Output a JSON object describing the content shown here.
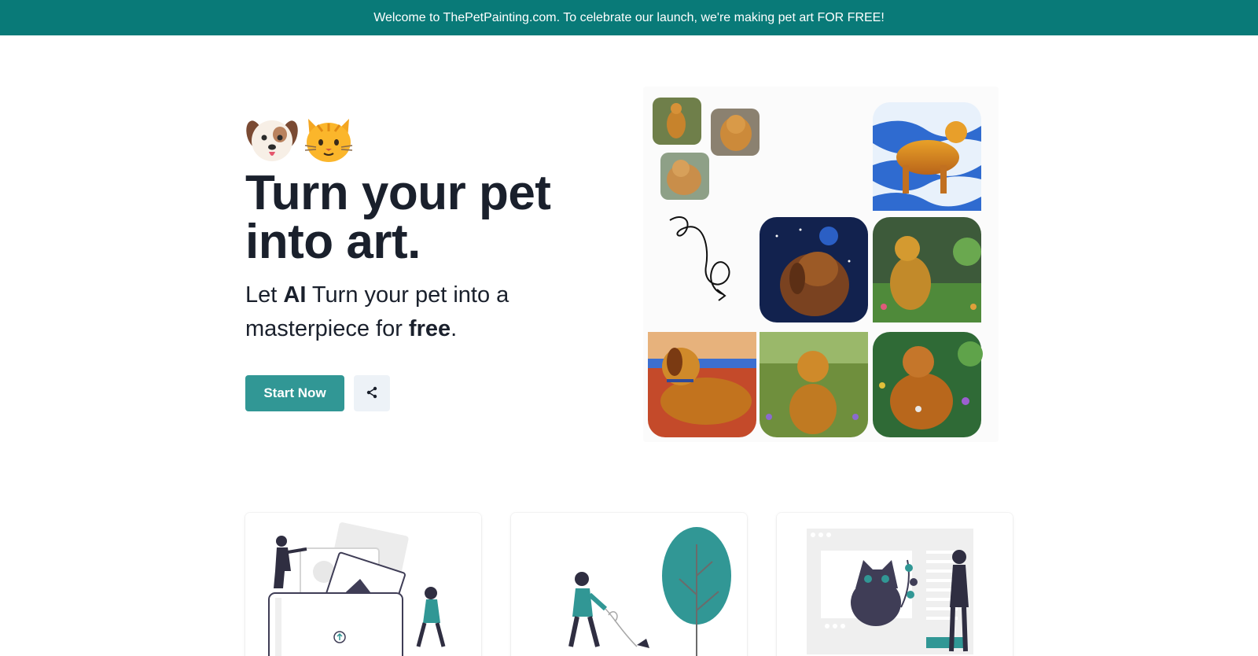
{
  "banner": {
    "text": "Welcome to ThePetPainting.com. To celebrate our launch, we're making pet art FOR FREE!"
  },
  "hero": {
    "emojis": [
      "dog-face-icon",
      "cat-face-icon"
    ],
    "headline": "Turn your pet into art.",
    "subline": {
      "part1": "Let ",
      "bold1": "AI",
      "part2": " Turn your pet into a masterpiece for ",
      "bold2": "free",
      "part3": "."
    },
    "start_label": "Start Now",
    "share_icon": "share-icon"
  },
  "gallery": {
    "items": [
      "dog-photo-small-1",
      "dog-photo-small-2",
      "dog-photo-small-3",
      "dog-painting-wave-background",
      "curly-arrow-icon",
      "dog-painting-night-sky",
      "dog-painting-garden-1",
      "dog-painting-desert",
      "dog-painting-garden-2",
      "dog-painting-garden-3"
    ]
  },
  "cards": [
    {
      "illustration": "upload-photo-illustration"
    },
    {
      "illustration": "walking-dog-tree-illustration"
    },
    {
      "illustration": "cat-painting-illustration"
    }
  ],
  "colors": {
    "banner_bg": "#097a78",
    "accent": "#319795",
    "text": "#1a202c"
  }
}
